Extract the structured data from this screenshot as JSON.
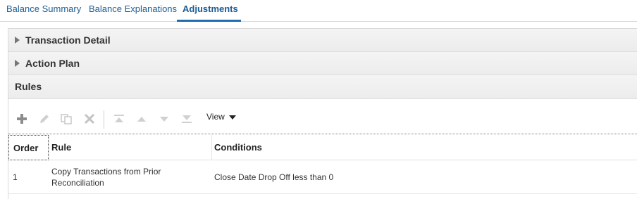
{
  "tabs": [
    {
      "label": "Balance Summary",
      "active": false
    },
    {
      "label": "Balance Explanations",
      "active": false
    },
    {
      "label": "Adjustments",
      "active": true
    }
  ],
  "sections": {
    "transaction_detail": "Transaction Detail",
    "action_plan": "Action Plan",
    "rules": "Rules"
  },
  "toolbar": {
    "icons": [
      "add-icon",
      "edit-icon",
      "duplicate-icon",
      "delete-icon",
      "move-top-icon",
      "move-up-icon",
      "move-down-icon",
      "move-bottom-icon"
    ],
    "view_label": "View"
  },
  "table": {
    "headers": {
      "order": "Order",
      "rule": "Rule",
      "conditions": "Conditions"
    },
    "rows": [
      {
        "order": "1",
        "rule": "Copy Transactions from Prior Reconciliation",
        "conditions": "Close Date Drop Off less than 0"
      }
    ]
  },
  "colors": {
    "tab_text": "#1f5e94",
    "tab_active_underline": "#1f6db1",
    "header_bg": "#f0f0f0"
  }
}
